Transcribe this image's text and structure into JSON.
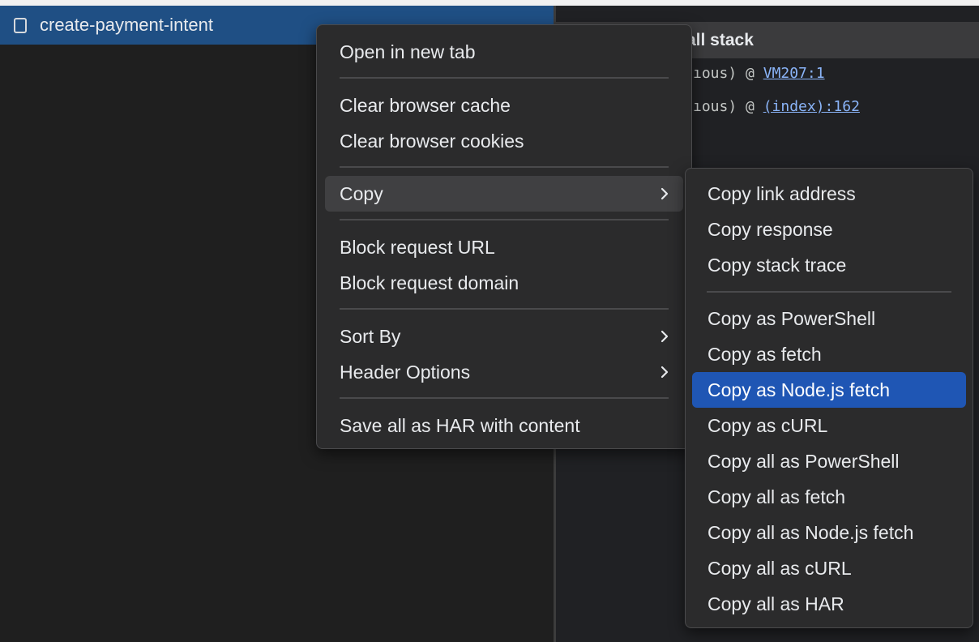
{
  "request": {
    "name": "create-payment-intent"
  },
  "call_stack": {
    "title": "all stack",
    "lines": [
      {
        "prefix": "ıous) @ ",
        "link": "VM207:1"
      },
      {
        "prefix": "ıous) @ ",
        "link": "(index):162"
      }
    ]
  },
  "context_menu": {
    "open_new_tab": "Open in new tab",
    "clear_cache": "Clear browser cache",
    "clear_cookies": "Clear browser cookies",
    "copy": "Copy",
    "block_url": "Block request URL",
    "block_domain": "Block request domain",
    "sort_by": "Sort By",
    "header_options": "Header Options",
    "save_har": "Save all as HAR with content"
  },
  "copy_submenu": {
    "items": [
      "Copy link address",
      "Copy response",
      "Copy stack trace",
      "Copy as PowerShell",
      "Copy as fetch",
      "Copy as Node.js fetch",
      "Copy as cURL",
      "Copy all as PowerShell",
      "Copy all as fetch",
      "Copy all as Node.js fetch",
      "Copy all as cURL",
      "Copy all as HAR"
    ],
    "highlighted": "Copy as Node.js fetch"
  },
  "colors": {
    "selected_row": "#1f4f84",
    "highlight": "#1f56b4",
    "link": "#8ab4f8",
    "menu_bg": "#2b2b2c"
  }
}
